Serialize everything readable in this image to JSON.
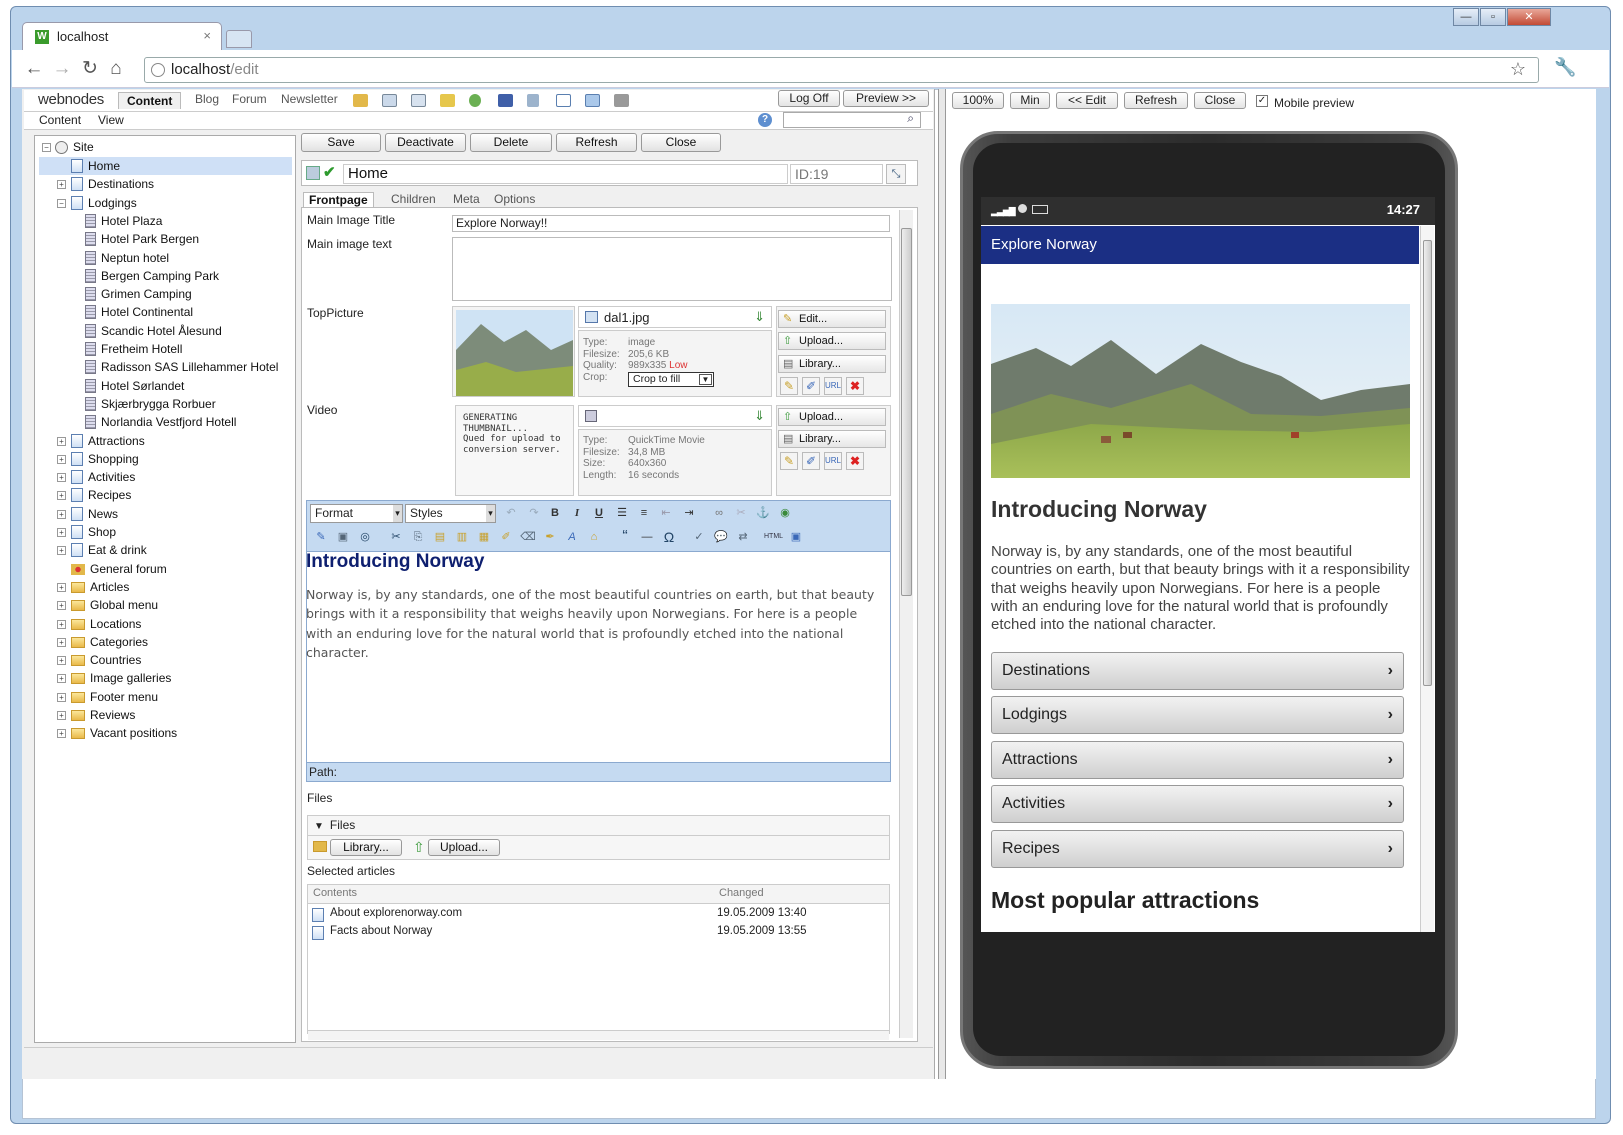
{
  "browser": {
    "tab_title": "localhost",
    "url_host": "localhost",
    "url_path": "/edit"
  },
  "cms": {
    "logo": "webnodes",
    "tabs": [
      "Content",
      "Blog",
      "Forum",
      "Newsletter"
    ],
    "menu": [
      "Content",
      "View"
    ],
    "log_off": "Log Off",
    "preview": "Preview >>"
  },
  "tree": {
    "root": "Site",
    "items": [
      {
        "label": "Home",
        "type": "page",
        "level": 1,
        "selected": true
      },
      {
        "label": "Destinations",
        "type": "page",
        "level": 1,
        "expander": "+"
      },
      {
        "label": "Lodgings",
        "type": "page",
        "level": 1,
        "expander": "-"
      },
      {
        "label": "Hotel Plaza",
        "type": "hotel",
        "level": 2
      },
      {
        "label": "Hotel Park Bergen",
        "type": "hotel",
        "level": 2
      },
      {
        "label": "Neptun hotel",
        "type": "hotel",
        "level": 2
      },
      {
        "label": "Bergen Camping Park",
        "type": "hotel",
        "level": 2
      },
      {
        "label": "Grimen Camping",
        "type": "hotel",
        "level": 2
      },
      {
        "label": "Hotel Continental",
        "type": "hotel",
        "level": 2
      },
      {
        "label": "Scandic Hotel Ålesund",
        "type": "hotel",
        "level": 2
      },
      {
        "label": "Fretheim Hotell",
        "type": "hotel",
        "level": 2
      },
      {
        "label": "Radisson SAS Lillehammer Hotel",
        "type": "hotel",
        "level": 2
      },
      {
        "label": "Hotel Sørlandet",
        "type": "hotel",
        "level": 2
      },
      {
        "label": "Skjærbrygga Rorbuer",
        "type": "hotel",
        "level": 2
      },
      {
        "label": "Norlandia Vestfjord Hotell",
        "type": "hotel",
        "level": 2
      },
      {
        "label": "Attractions",
        "type": "page",
        "level": 1,
        "expander": "+"
      },
      {
        "label": "Shopping",
        "type": "page",
        "level": 1,
        "expander": "+"
      },
      {
        "label": "Activities",
        "type": "page",
        "level": 1,
        "expander": "+"
      },
      {
        "label": "Recipes",
        "type": "page",
        "level": 1,
        "expander": "+"
      },
      {
        "label": "News",
        "type": "page",
        "level": 1,
        "expander": "+"
      },
      {
        "label": "Shop",
        "type": "page",
        "level": 1,
        "expander": "+"
      },
      {
        "label": "Eat & drink",
        "type": "page",
        "level": 1,
        "expander": "+"
      },
      {
        "label": "General forum",
        "type": "forum",
        "level": 1
      },
      {
        "label": "Articles",
        "type": "folder",
        "level": 1,
        "expander": "+"
      },
      {
        "label": "Global menu",
        "type": "folder",
        "level": 1,
        "expander": "+"
      },
      {
        "label": "Locations",
        "type": "folder",
        "level": 1,
        "expander": "+"
      },
      {
        "label": "Categories",
        "type": "folder",
        "level": 1,
        "expander": "+"
      },
      {
        "label": "Countries",
        "type": "folder",
        "level": 1,
        "expander": "+"
      },
      {
        "label": "Image galleries",
        "type": "folder",
        "level": 1,
        "expander": "+"
      },
      {
        "label": "Footer menu",
        "type": "folder",
        "level": 1,
        "expander": "+"
      },
      {
        "label": "Reviews",
        "type": "folder",
        "level": 1,
        "expander": "+"
      },
      {
        "label": "Vacant positions",
        "type": "folder",
        "level": 1,
        "expander": "+"
      }
    ]
  },
  "editor": {
    "buttons": [
      "Save",
      "Deactivate",
      "Delete",
      "Refresh",
      "Close"
    ],
    "title": "Home",
    "id": "ID:19",
    "tabs": [
      "Frontpage",
      "Children",
      "Meta",
      "Options"
    ],
    "main_image_title_label": "Main Image Title",
    "main_image_title_value": "Explore Norway!!",
    "main_image_text_label": "Main image text",
    "top_picture_label": "TopPicture",
    "video_label": "Video",
    "picture": {
      "file": "dal1.jpg",
      "type_k": "Type:",
      "type_v": "image",
      "size_k": "Filesize:",
      "size_v": "205,6 KB",
      "quality_k": "Quality:",
      "quality_v": "989x335",
      "quality_flag": "Low",
      "crop_k": "Crop:",
      "crop_v": "Crop to fill"
    },
    "picture_buttons": [
      "Edit...",
      "Upload...",
      "Library..."
    ],
    "video": {
      "status": "GENERATING THUMBNAIL...",
      "status_note": "Qued for upload to conversion server.",
      "type_k": "Type:",
      "type_v": "QuickTime Movie",
      "size_k": "Filesize:",
      "size_v": "34,8 MB",
      "dim_k": "Size:",
      "dim_v": "640x360",
      "length_k": "Length:",
      "length_v": "16 seconds"
    },
    "video_buttons": [
      "Upload...",
      "Library..."
    ],
    "rte": {
      "format": "Format",
      "styles": "Styles",
      "heading": "Introducing Norway",
      "body": "Norway is, by any standards, one of the most beautiful countries on earth, but that beauty brings with it a responsibility that weighs heavily upon Norwegians. For here is a people with an enduring love for the natural world that is profoundly etched into the national character.",
      "path_label": "Path:"
    },
    "files_label": "Files",
    "files_section": "Files",
    "files_buttons": [
      "Library...",
      "Upload..."
    ],
    "selected_articles_label": "Selected articles",
    "articles_headers": [
      "Contents",
      "Changed"
    ],
    "articles": [
      {
        "title": "About explorenorway.com",
        "changed": "19.05.2009 13:40"
      },
      {
        "title": "Facts about Norway",
        "changed": "19.05.2009 13:55"
      }
    ]
  },
  "preview": {
    "buttons": [
      "100%",
      "Min",
      "<< Edit",
      "Refresh",
      "Close"
    ],
    "mobile_label": "Mobile preview",
    "mobile_checked": true,
    "time": "14:27",
    "app_title": "Explore Norway",
    "heading": "Introducing Norway",
    "body": "Norway is, by any standards, one of the most beautiful countries on earth, but that beauty brings with it a responsibility that weighs heavily upon Norwegians. For here is a people with an enduring love for the natural world that is profoundly etched into the national character.",
    "nav": [
      "Destinations",
      "Lodgings",
      "Attractions",
      "Activities",
      "Recipes"
    ],
    "heading2": "Most popular attractions"
  }
}
